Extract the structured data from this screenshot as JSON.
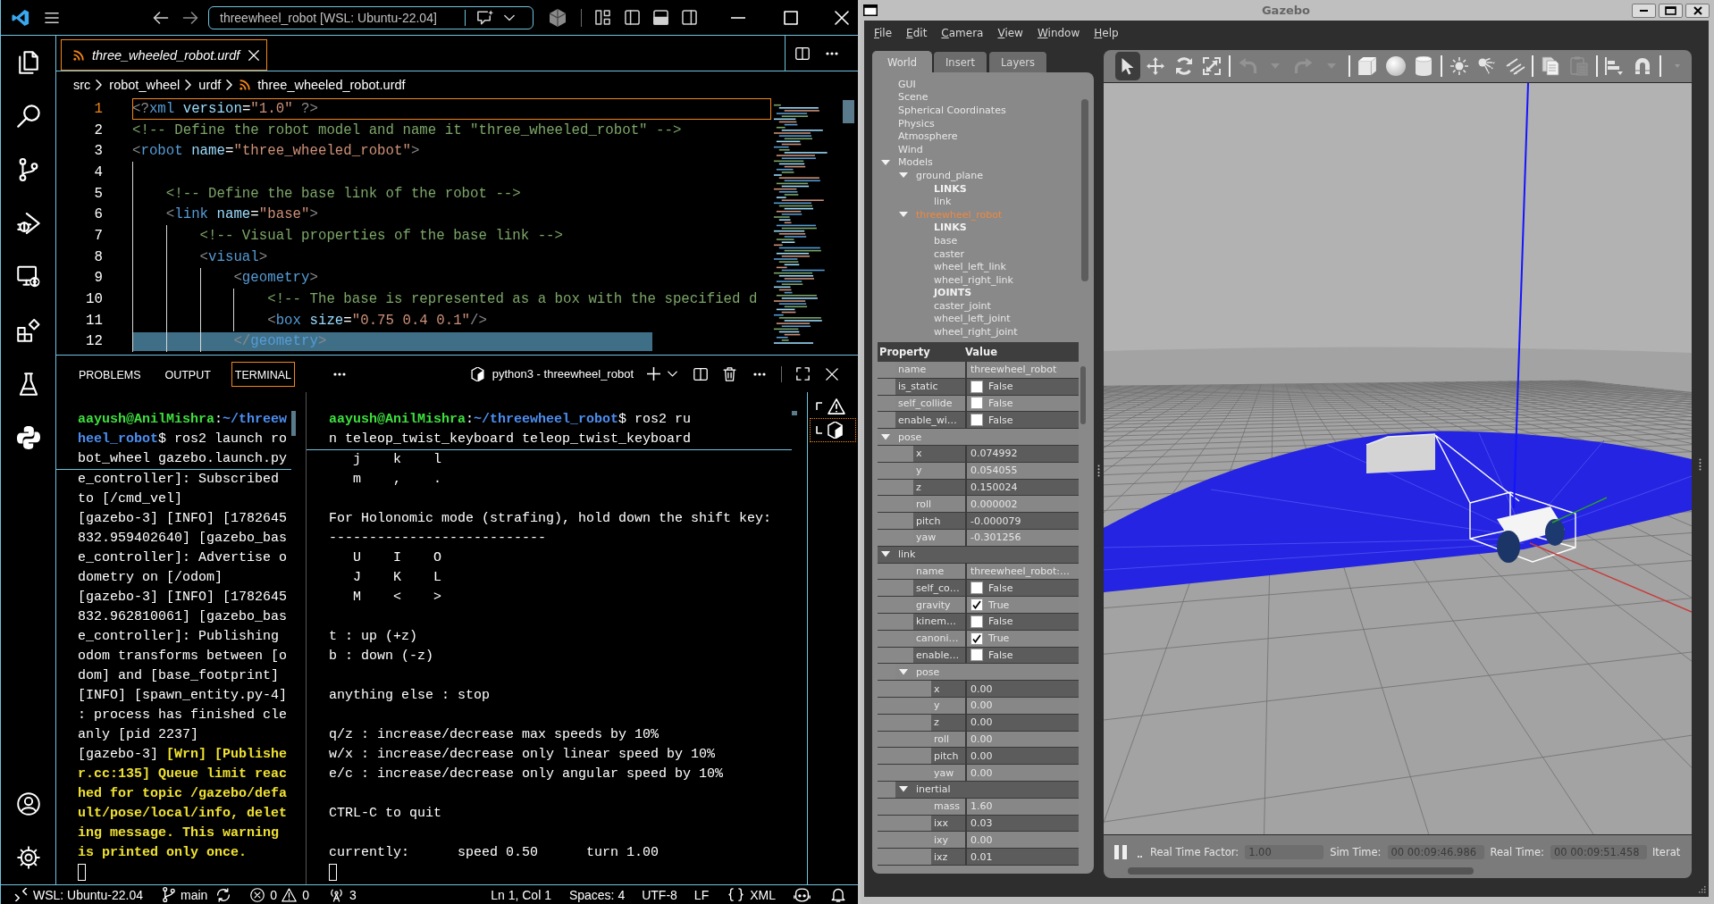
{
  "vscode": {
    "command_center": "threewheel_robot [WSL: Ubuntu-22.04]",
    "editor_tabs": [
      {
        "label": "three_wheeled_robot.urdf",
        "selected": true
      }
    ],
    "breadcrumb": [
      "src",
      "robot_wheel",
      "urdf",
      "three_wheeled_robot.urdf"
    ],
    "editor": {
      "lines": [
        {
          "number": "1",
          "code": "<?xml version=\"1.0\" ?>",
          "current": true,
          "selected": false
        },
        {
          "number": "2",
          "code": "<!-- Define the robot model and name it \"three_wheeled_robot\" -->",
          "current": false,
          "selected": false
        },
        {
          "number": "3",
          "code": "<robot name=\"three_wheeled_robot\">",
          "current": false,
          "selected": false
        },
        {
          "number": "4",
          "current": false,
          "selected": false
        },
        {
          "number": "5",
          "code": "    <!-- Define the base link of the robot -->",
          "current": false,
          "selected": false
        },
        {
          "number": "6",
          "code": "    <link name=\"base\">",
          "current": false,
          "selected": false
        },
        {
          "number": "7",
          "code": "        <!-- Visual properties of the base link -->",
          "current": false,
          "selected": false
        },
        {
          "number": "8",
          "code": "        <visual>",
          "current": false,
          "selected": false
        },
        {
          "number": "9",
          "code": "            <geometry>",
          "current": false,
          "selected": false
        },
        {
          "number": "10",
          "code": "                <!-- The base is represented as a box with the specified d",
          "current": false,
          "selected": false
        },
        {
          "number": "11",
          "code": "                <box size=\"0.75 0.4 0.1\"/>",
          "current": false,
          "selected": false
        },
        {
          "number": "12",
          "code": "            </geometry>",
          "current": false,
          "selected": true
        }
      ]
    },
    "panel_tabs": [
      {
        "label": "PROBLEMS",
        "selected": false
      },
      {
        "label": "OUTPUT",
        "selected": false
      },
      {
        "label": "TERMINAL",
        "selected": true
      }
    ],
    "terminal": {
      "title": "python3 - threewheel_robot",
      "panes": [
        {
          "sticky": [
            [
              {
                "text": "aayush@AnilMishra",
                "kind": "user"
              },
              {
                "text": ":",
                "kind": "plain"
              },
              {
                "text": "~/threew",
                "kind": "path"
              }
            ],
            [
              {
                "text": "heel_robot",
                "kind": "path"
              },
              {
                "text": "$ ros2 launch ro",
                "kind": "plain"
              }
            ],
            "bot_wheel gazebo.launch.py"
          ],
          "blocks": [
            [
              "e_controller]: Subscribed",
              "to [/cmd_vel]",
              "[gazebo-3] [INFO] [1782645",
              "832.959402640] [gazebo_bas",
              "e_controller]: Advertise o",
              "dometry on [/odom]",
              "[gazebo-3] [INFO] [1782645",
              "832.962810061] [gazebo_bas",
              "e_controller]: Publishing",
              "odom transforms between [o",
              "dom] and [base_footprint]",
              "[INFO] [spawn_entity.py-4]",
              ": process has finished cle",
              "anly [pid 2237]",
              [
                {
                  "text": "[gazebo-3] ",
                  "kind": "plain"
                },
                {
                  "text": "[Wrn] [Publishe",
                  "kind": "warning"
                }
              ],
              [
                {
                  "text": "r.cc:135] Queue limit reac",
                  "kind": "warning"
                }
              ],
              [
                {
                  "text": "hed for topic /gazebo/defa",
                  "kind": "warning"
                }
              ],
              [
                {
                  "text": "ult/pose/local/info, delet",
                  "kind": "warning"
                }
              ],
              [
                {
                  "text": "ing message. This warning",
                  "kind": "warning"
                }
              ],
              [
                {
                  "text": "is printed only once.",
                  "kind": "warning"
                }
              ]
            ]
          ]
        },
        {
          "sticky": [
            [
              {
                "text": "aayush@AnilMishra",
                "kind": "user"
              },
              {
                "text": ":",
                "kind": "plain"
              },
              {
                "text": "~/threewheel_robot",
                "kind": "path"
              },
              {
                "text": "$ ros2 ru",
                "kind": "plain"
              }
            ],
            "n teleop_twist_keyboard teleop_twist_keyboard"
          ],
          "blocks": [
            [
              "   j    k    l",
              "   m    ,    ."
            ],
            [
              "For Holonomic mode (strafing), hold down the shift key:",
              "---------------------------",
              "   U    I    O",
              "   J    K    L",
              "   M    <    >"
            ],
            [
              "t : up (+z)",
              "b : down (-z)"
            ],
            [
              "anything else : stop"
            ],
            [
              "q/z : increase/decrease max speeds by 10%",
              "w/x : increase/decrease only linear speed by 10%",
              "e/c : increase/decrease only angular speed by 10%"
            ],
            [
              "CTRL-C to quit"
            ],
            [
              "currently:      speed 0.50      turn 1.00"
            ]
          ]
        }
      ],
      "instances": [
        {
          "kind": "warning",
          "selected": false
        },
        {
          "kind": "shell",
          "selected": true
        }
      ]
    },
    "status_bar": {
      "remote": "WSL: Ubuntu-22.04",
      "branch": "main",
      "errors": "0",
      "warnings": "0",
      "ports": "3",
      "cursor_position": "Ln 1, Col 1",
      "indentation": "Spaces: 4",
      "encoding": "UTF-8",
      "line_ending": "LF",
      "language": "XML"
    }
  },
  "gazebo": {
    "title": "Gazebo",
    "menu": [
      "File",
      "Edit",
      "Camera",
      "View",
      "Window",
      "Help"
    ],
    "side_tabs": [
      {
        "label": "World",
        "selected": true
      },
      {
        "label": "Insert",
        "selected": false
      },
      {
        "label": "Layers",
        "selected": false
      }
    ],
    "world_tree": [
      {
        "label": "GUI",
        "kind": "item",
        "selected": false
      },
      {
        "label": "Scene",
        "kind": "item",
        "selected": false
      },
      {
        "label": "Spherical Coordinates",
        "kind": "item",
        "selected": false
      },
      {
        "label": "Physics",
        "kind": "item",
        "selected": false
      },
      {
        "label": "Atmosphere",
        "kind": "item",
        "selected": false
      },
      {
        "label": "Wind",
        "kind": "item",
        "selected": false
      },
      {
        "label": "Models",
        "kind": "item",
        "selected": false,
        "expanded": true,
        "children": [
          {
            "label": "ground_plane",
            "kind": "item",
            "selected": false,
            "expanded": true,
            "children": [
              {
                "label": "LINKS",
                "kind": "header"
              },
              {
                "label": "link",
                "kind": "item",
                "selected": false
              }
            ]
          },
          {
            "label": "threewheel_robot",
            "kind": "item",
            "selected": true,
            "expanded": true,
            "children": [
              {
                "label": "LINKS",
                "kind": "header"
              },
              {
                "label": "base",
                "kind": "item",
                "selected": false
              },
              {
                "label": "caster",
                "kind": "item",
                "selected": false
              },
              {
                "label": "wheel_left_link",
                "kind": "item",
                "selected": false
              },
              {
                "label": "wheel_right_link",
                "kind": "item",
                "selected": false
              },
              {
                "label": "JOINTS",
                "kind": "header"
              },
              {
                "label": "caster_joint",
                "kind": "item",
                "selected": false
              },
              {
                "label": "wheel_left_joint",
                "kind": "item",
                "selected": false
              },
              {
                "label": "wheel_right_joint",
                "kind": "item",
                "selected": false
              }
            ]
          }
        ]
      }
    ],
    "properties": {
      "columns": [
        "Property",
        "Value"
      ],
      "rows": [
        {
          "kind": "text",
          "label": "name",
          "value": "threewheel_robot"
        },
        {
          "kind": "checkbox",
          "label": "is_static",
          "checked": false,
          "value": "False"
        },
        {
          "kind": "checkbox",
          "label": "self_collide",
          "checked": false,
          "value": "False"
        },
        {
          "kind": "checkbox",
          "label": "enable_wi…",
          "checked": false,
          "value": "False"
        },
        {
          "kind": "group",
          "label": "pose",
          "expanded": true,
          "children": [
            {
              "kind": "text",
              "label": "x",
              "value": "0.074992"
            },
            {
              "kind": "text",
              "label": "y",
              "value": "0.054055"
            },
            {
              "kind": "text",
              "label": "z",
              "value": "0.150024"
            },
            {
              "kind": "text",
              "label": "roll",
              "value": "0.000002"
            },
            {
              "kind": "text",
              "label": "pitch",
              "value": "-0.000079"
            },
            {
              "kind": "text",
              "label": "yaw",
              "value": "-0.301256"
            }
          ]
        },
        {
          "kind": "group",
          "label": "link",
          "expanded": true,
          "children": [
            {
              "kind": "text",
              "label": "name",
              "value": "threewheel_robot:…"
            },
            {
              "kind": "checkbox",
              "label": "self_co…",
              "checked": false,
              "value": "False"
            },
            {
              "kind": "checkbox",
              "label": "gravity",
              "checked": true,
              "value": "True"
            },
            {
              "kind": "checkbox",
              "label": "kinem…",
              "checked": false,
              "value": "False"
            },
            {
              "kind": "checkbox",
              "label": "canoni…",
              "checked": true,
              "value": "True"
            },
            {
              "kind": "checkbox",
              "label": "enable…",
              "checked": false,
              "value": "False"
            },
            {
              "kind": "group",
              "label": "pose",
              "expanded": true,
              "children": [
                {
                  "kind": "text",
                  "label": "x",
                  "value": "0.00"
                },
                {
                  "kind": "text",
                  "label": "y",
                  "value": "0.00"
                },
                {
                  "kind": "text",
                  "label": "z",
                  "value": "0.00"
                },
                {
                  "kind": "text",
                  "label": "roll",
                  "value": "0.00"
                },
                {
                  "kind": "text",
                  "label": "pitch",
                  "value": "0.00"
                },
                {
                  "kind": "text",
                  "label": "yaw",
                  "value": "0.00"
                }
              ]
            },
            {
              "kind": "group",
              "label": "inertial",
              "expanded": true,
              "children": [
                {
                  "kind": "text",
                  "label": "mass",
                  "value": "1.60"
                },
                {
                  "kind": "text",
                  "label": "ixx",
                  "value": "0.03"
                },
                {
                  "kind": "text",
                  "label": "ixy",
                  "value": "0.00"
                },
                {
                  "kind": "text",
                  "label": "ixz",
                  "value": "0.01"
                }
              ]
            }
          ]
        }
      ]
    },
    "toolbar": [
      {
        "kind": "select",
        "selected": true,
        "disabled": false
      },
      {
        "kind": "translate",
        "selected": false,
        "disabled": false
      },
      {
        "kind": "rotate",
        "selected": false,
        "disabled": false
      },
      {
        "kind": "scale",
        "selected": false,
        "disabled": false
      },
      {
        "kind": "separator"
      },
      {
        "kind": "undo",
        "selected": false,
        "disabled": true
      },
      {
        "kind": "dropdown",
        "selected": false,
        "disabled": true
      },
      {
        "kind": "redo",
        "selected": false,
        "disabled": true
      },
      {
        "kind": "dropdown",
        "selected": false,
        "disabled": true
      },
      {
        "kind": "separator"
      },
      {
        "kind": "box",
        "selected": false,
        "disabled": false
      },
      {
        "kind": "sphere",
        "selected": false,
        "disabled": false
      },
      {
        "kind": "cylinder",
        "selected": false,
        "disabled": false
      },
      {
        "kind": "separator"
      },
      {
        "kind": "pointlight",
        "selected": false,
        "disabled": false
      },
      {
        "kind": "spotlight",
        "selected": false,
        "disabled": false
      },
      {
        "kind": "dirlight",
        "selected": false,
        "disabled": false
      },
      {
        "kind": "separator"
      },
      {
        "kind": "copy",
        "selected": false,
        "disabled": false
      },
      {
        "kind": "paste",
        "selected": false,
        "disabled": true
      },
      {
        "kind": "separator"
      },
      {
        "kind": "align",
        "selected": false,
        "disabled": false
      },
      {
        "kind": "snap",
        "selected": false,
        "disabled": false
      },
      {
        "kind": "separator"
      },
      {
        "kind": "overflow"
      }
    ],
    "status": {
      "playing": true,
      "real_time_factor_label": "Real Time Factor:",
      "real_time_factor": "1.00",
      "sim_time_label": "Sim Time:",
      "sim_time": "00 00:09:46.986",
      "real_time_label": "Real Time:",
      "real_time": "00 00:09:51.458",
      "iterations_label": "Iterat"
    }
  }
}
